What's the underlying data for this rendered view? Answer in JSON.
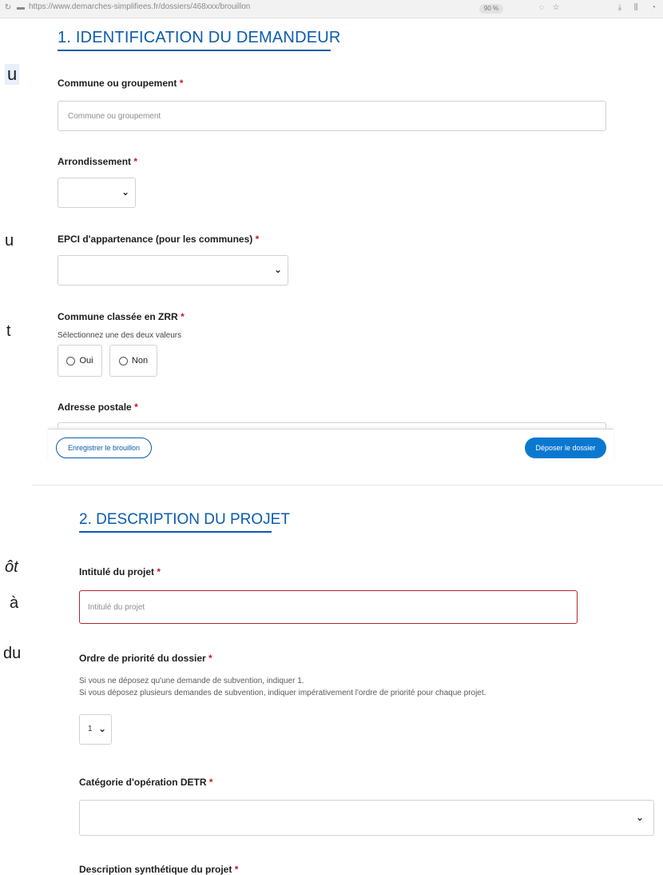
{
  "browser": {
    "url": "https://www.demarches-simplifiees.fr/dossiers/468xxx/brouillon",
    "zoom": "90 %"
  },
  "doc_fragments": [
    "u",
    "u",
    "t",
    "ôt",
    "à",
    "du"
  ],
  "section1": {
    "title": "1. IDENTIFICATION DU DEMANDEUR",
    "commune": {
      "label": "Commune ou groupement",
      "placeholder": "Commune ou groupement"
    },
    "arrondissement": {
      "label": "Arrondissement",
      "value": ""
    },
    "epci": {
      "label": "EPCI d'appartenance (pour les communes)",
      "value": ""
    },
    "zrr": {
      "label": "Commune classée en ZRR",
      "hint": "Sélectionnez une des deux valeurs",
      "options": [
        "Oui",
        "Non"
      ]
    },
    "adresse": {
      "label": "Adresse postale"
    }
  },
  "footer": {
    "secondary_label": "Enregistrer le brouillon",
    "primary_label": "Déposer le dossier"
  },
  "required_mark": "*",
  "section2": {
    "title": "2. DESCRIPTION DU PROJET",
    "intitule": {
      "label": "Intitulé du projet",
      "placeholder": "Intitulé du projet"
    },
    "priorite": {
      "label": "Ordre de priorité du dossier",
      "hint1": "Si vous ne déposez qu'une demande de subvention, indiquer 1.",
      "hint2": "Si vous déposez plusieurs demandes de subvention, indiquer impérativement l'ordre de priorité pour chaque projet.",
      "value": "1"
    },
    "categorie": {
      "label": "Catégorie d'opération DETR",
      "value": ""
    },
    "description": {
      "label": "Description synthétique du projet"
    }
  },
  "colors": {
    "accent": "#0b5cad",
    "required": "#c9191e",
    "error_border": "#b0262d"
  }
}
